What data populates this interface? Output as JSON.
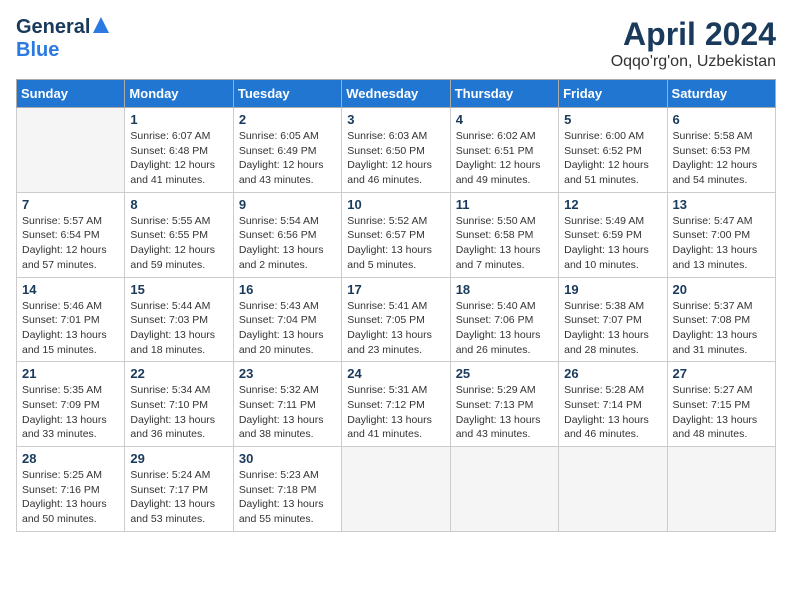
{
  "logo": {
    "general": "General",
    "blue": "Blue"
  },
  "title": "April 2024",
  "location": "Oqqo'rg'on, Uzbekistan",
  "weekdays": [
    "Sunday",
    "Monday",
    "Tuesday",
    "Wednesday",
    "Thursday",
    "Friday",
    "Saturday"
  ],
  "weeks": [
    [
      {
        "day": "",
        "sunrise": "",
        "sunset": "",
        "daylight": ""
      },
      {
        "day": "1",
        "sunrise": "Sunrise: 6:07 AM",
        "sunset": "Sunset: 6:48 PM",
        "daylight": "Daylight: 12 hours and 41 minutes."
      },
      {
        "day": "2",
        "sunrise": "Sunrise: 6:05 AM",
        "sunset": "Sunset: 6:49 PM",
        "daylight": "Daylight: 12 hours and 43 minutes."
      },
      {
        "day": "3",
        "sunrise": "Sunrise: 6:03 AM",
        "sunset": "Sunset: 6:50 PM",
        "daylight": "Daylight: 12 hours and 46 minutes."
      },
      {
        "day": "4",
        "sunrise": "Sunrise: 6:02 AM",
        "sunset": "Sunset: 6:51 PM",
        "daylight": "Daylight: 12 hours and 49 minutes."
      },
      {
        "day": "5",
        "sunrise": "Sunrise: 6:00 AM",
        "sunset": "Sunset: 6:52 PM",
        "daylight": "Daylight: 12 hours and 51 minutes."
      },
      {
        "day": "6",
        "sunrise": "Sunrise: 5:58 AM",
        "sunset": "Sunset: 6:53 PM",
        "daylight": "Daylight: 12 hours and 54 minutes."
      }
    ],
    [
      {
        "day": "7",
        "sunrise": "Sunrise: 5:57 AM",
        "sunset": "Sunset: 6:54 PM",
        "daylight": "Daylight: 12 hours and 57 minutes."
      },
      {
        "day": "8",
        "sunrise": "Sunrise: 5:55 AM",
        "sunset": "Sunset: 6:55 PM",
        "daylight": "Daylight: 12 hours and 59 minutes."
      },
      {
        "day": "9",
        "sunrise": "Sunrise: 5:54 AM",
        "sunset": "Sunset: 6:56 PM",
        "daylight": "Daylight: 13 hours and 2 minutes."
      },
      {
        "day": "10",
        "sunrise": "Sunrise: 5:52 AM",
        "sunset": "Sunset: 6:57 PM",
        "daylight": "Daylight: 13 hours and 5 minutes."
      },
      {
        "day": "11",
        "sunrise": "Sunrise: 5:50 AM",
        "sunset": "Sunset: 6:58 PM",
        "daylight": "Daylight: 13 hours and 7 minutes."
      },
      {
        "day": "12",
        "sunrise": "Sunrise: 5:49 AM",
        "sunset": "Sunset: 6:59 PM",
        "daylight": "Daylight: 13 hours and 10 minutes."
      },
      {
        "day": "13",
        "sunrise": "Sunrise: 5:47 AM",
        "sunset": "Sunset: 7:00 PM",
        "daylight": "Daylight: 13 hours and 13 minutes."
      }
    ],
    [
      {
        "day": "14",
        "sunrise": "Sunrise: 5:46 AM",
        "sunset": "Sunset: 7:01 PM",
        "daylight": "Daylight: 13 hours and 15 minutes."
      },
      {
        "day": "15",
        "sunrise": "Sunrise: 5:44 AM",
        "sunset": "Sunset: 7:03 PM",
        "daylight": "Daylight: 13 hours and 18 minutes."
      },
      {
        "day": "16",
        "sunrise": "Sunrise: 5:43 AM",
        "sunset": "Sunset: 7:04 PM",
        "daylight": "Daylight: 13 hours and 20 minutes."
      },
      {
        "day": "17",
        "sunrise": "Sunrise: 5:41 AM",
        "sunset": "Sunset: 7:05 PM",
        "daylight": "Daylight: 13 hours and 23 minutes."
      },
      {
        "day": "18",
        "sunrise": "Sunrise: 5:40 AM",
        "sunset": "Sunset: 7:06 PM",
        "daylight": "Daylight: 13 hours and 26 minutes."
      },
      {
        "day": "19",
        "sunrise": "Sunrise: 5:38 AM",
        "sunset": "Sunset: 7:07 PM",
        "daylight": "Daylight: 13 hours and 28 minutes."
      },
      {
        "day": "20",
        "sunrise": "Sunrise: 5:37 AM",
        "sunset": "Sunset: 7:08 PM",
        "daylight": "Daylight: 13 hours and 31 minutes."
      }
    ],
    [
      {
        "day": "21",
        "sunrise": "Sunrise: 5:35 AM",
        "sunset": "Sunset: 7:09 PM",
        "daylight": "Daylight: 13 hours and 33 minutes."
      },
      {
        "day": "22",
        "sunrise": "Sunrise: 5:34 AM",
        "sunset": "Sunset: 7:10 PM",
        "daylight": "Daylight: 13 hours and 36 minutes."
      },
      {
        "day": "23",
        "sunrise": "Sunrise: 5:32 AM",
        "sunset": "Sunset: 7:11 PM",
        "daylight": "Daylight: 13 hours and 38 minutes."
      },
      {
        "day": "24",
        "sunrise": "Sunrise: 5:31 AM",
        "sunset": "Sunset: 7:12 PM",
        "daylight": "Daylight: 13 hours and 41 minutes."
      },
      {
        "day": "25",
        "sunrise": "Sunrise: 5:29 AM",
        "sunset": "Sunset: 7:13 PM",
        "daylight": "Daylight: 13 hours and 43 minutes."
      },
      {
        "day": "26",
        "sunrise": "Sunrise: 5:28 AM",
        "sunset": "Sunset: 7:14 PM",
        "daylight": "Daylight: 13 hours and 46 minutes."
      },
      {
        "day": "27",
        "sunrise": "Sunrise: 5:27 AM",
        "sunset": "Sunset: 7:15 PM",
        "daylight": "Daylight: 13 hours and 48 minutes."
      }
    ],
    [
      {
        "day": "28",
        "sunrise": "Sunrise: 5:25 AM",
        "sunset": "Sunset: 7:16 PM",
        "daylight": "Daylight: 13 hours and 50 minutes."
      },
      {
        "day": "29",
        "sunrise": "Sunrise: 5:24 AM",
        "sunset": "Sunset: 7:17 PM",
        "daylight": "Daylight: 13 hours and 53 minutes."
      },
      {
        "day": "30",
        "sunrise": "Sunrise: 5:23 AM",
        "sunset": "Sunset: 7:18 PM",
        "daylight": "Daylight: 13 hours and 55 minutes."
      },
      {
        "day": "",
        "sunrise": "",
        "sunset": "",
        "daylight": ""
      },
      {
        "day": "",
        "sunrise": "",
        "sunset": "",
        "daylight": ""
      },
      {
        "day": "",
        "sunrise": "",
        "sunset": "",
        "daylight": ""
      },
      {
        "day": "",
        "sunrise": "",
        "sunset": "",
        "daylight": ""
      }
    ]
  ]
}
